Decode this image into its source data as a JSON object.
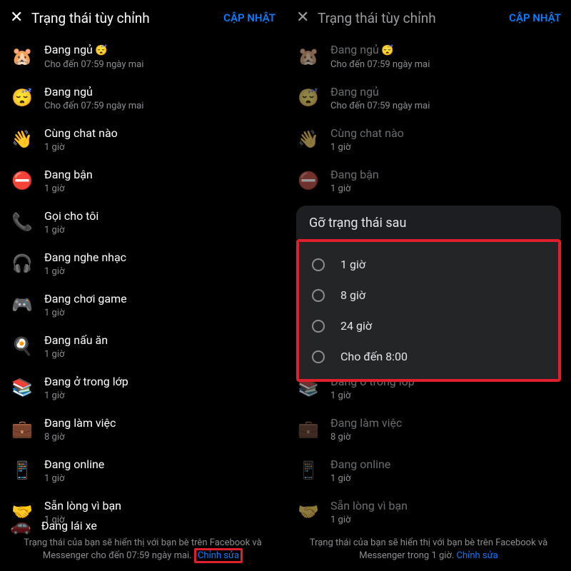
{
  "header": {
    "title": "Trạng thái tùy chỉnh",
    "update": "CẬP NHẬT"
  },
  "statuses": [
    {
      "emoji": "🐹",
      "title": "Đang ngủ",
      "sub": "Cho đến 07:59 ngày mai",
      "selected": true
    },
    {
      "emoji": "😴",
      "title": "Đang ngủ",
      "sub": "Cho đến 07:59 ngày mai"
    },
    {
      "emoji": "👋",
      "title": "Cùng chat nào",
      "sub": "1 giờ"
    },
    {
      "emoji": "⛔",
      "title": "Đang bận",
      "sub": "1 giờ"
    },
    {
      "emoji": "📞",
      "title": "Gọi cho tôi",
      "sub": "1 giờ"
    },
    {
      "emoji": "🎧",
      "title": "Đang nghe nhạc",
      "sub": "1 giờ"
    },
    {
      "emoji": "🎮",
      "title": "Đang chơi game",
      "sub": "1 giờ"
    },
    {
      "emoji": "🍳",
      "title": "Đang nấu ăn",
      "sub": "1 giờ"
    },
    {
      "emoji": "📚",
      "title": "Đang ở trong lớp",
      "sub": "1 giờ"
    },
    {
      "emoji": "💼",
      "title": "Đang làm việc",
      "sub": "8 giờ"
    },
    {
      "emoji": "📱",
      "title": "Đang online",
      "sub": "1 giờ"
    },
    {
      "emoji": "🤝",
      "title": "Sẵn lòng vì bạn",
      "sub": "1 giờ"
    }
  ],
  "cutoff": {
    "emoji": "🚗",
    "title": "Đang lái xe"
  },
  "footer1": {
    "text_a": "Trạng thái của bạn sẽ hiển thị với bạn bè trên Facebook và Messenger cho đến 07:59 ngày mai. ",
    "edit": "Chỉnh sửa"
  },
  "footer2": {
    "text_a": "Trạng thái của bạn sẽ hiển thị với bạn bè trên Facebook và Messenger trong 1 giờ. ",
    "edit": "Chỉnh sửa"
  },
  "sheet": {
    "title": "Gỡ trạng thái sau",
    "options": [
      "1 giờ",
      "8 giờ",
      "24 giờ",
      "Cho đến 8:00"
    ]
  }
}
